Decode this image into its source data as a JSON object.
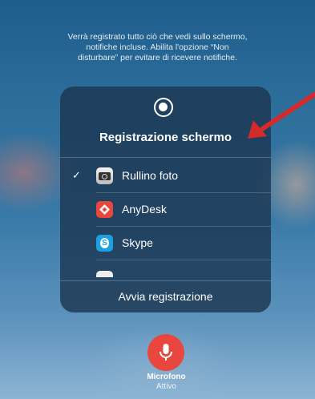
{
  "notice_lines": [
    "Verrà registrato tutto ciò che vedi sullo schermo,",
    "notifiche incluse. Abilita l'opzione “Non",
    "disturbare” per evitare di ricevere notifiche."
  ],
  "panel": {
    "title": "Registrazione schermo",
    "items": [
      {
        "label": "Rullino foto",
        "icon": "camera-icon",
        "selected": true,
        "check": "✓"
      },
      {
        "label": "AnyDesk",
        "icon": "anydesk-icon",
        "selected": false
      },
      {
        "label": "Skype",
        "icon": "skype-icon",
        "selected": false
      }
    ],
    "start_label": "Avvia registrazione"
  },
  "microphone": {
    "label": "Microfono",
    "status": "Attivo",
    "icon": "microphone-icon"
  },
  "colors": {
    "arrow": "#d42a2a",
    "mic_button": "#e9473d",
    "anydesk": "#e8473c",
    "skype": "#1ca0e0"
  }
}
